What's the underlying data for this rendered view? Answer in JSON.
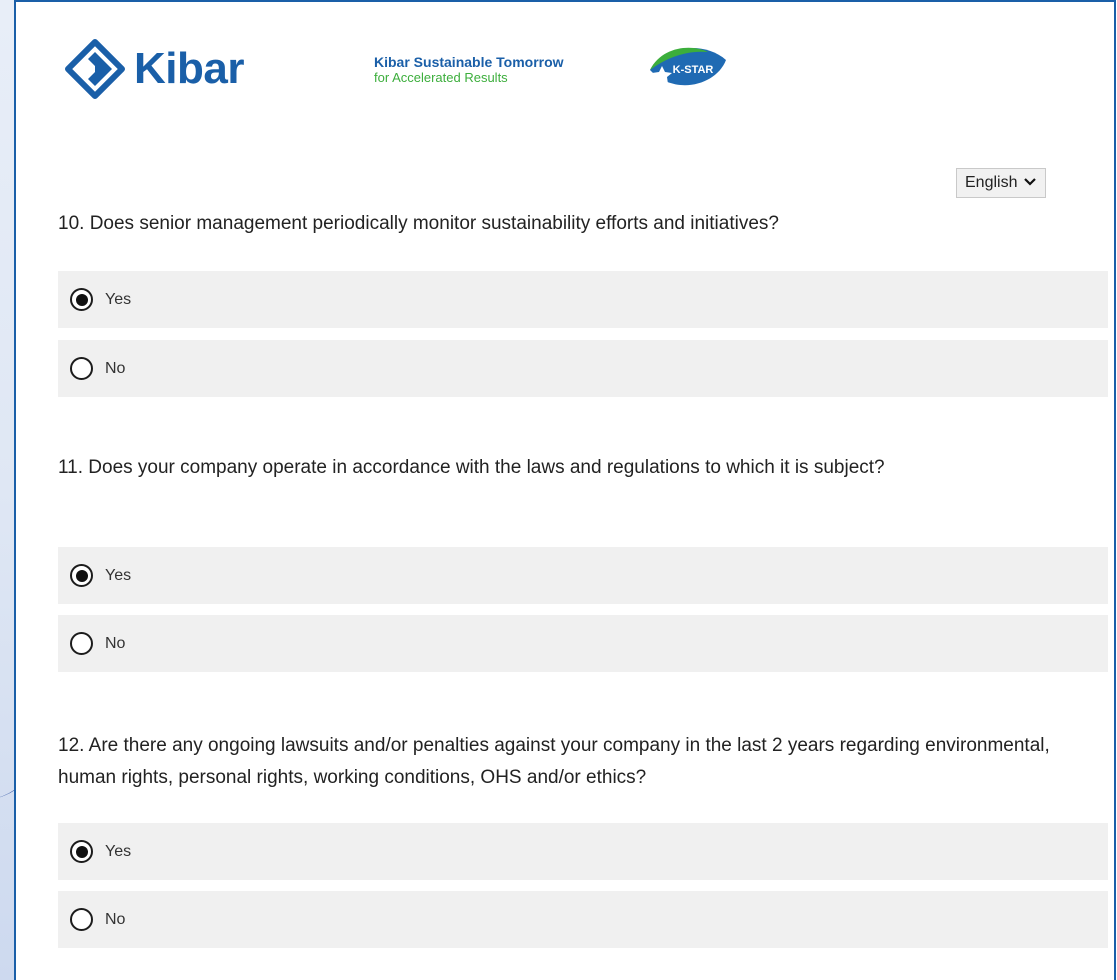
{
  "brand": {
    "name": "Kibar",
    "tagline_line1": "Kibar Sustainable Tomorrow",
    "tagline_line2": "for Accelerated Results",
    "badge": "K-STAR",
    "primary_color": "#1a5fa8",
    "accent_color": "#3cae3c"
  },
  "language": {
    "selected": "English"
  },
  "questions": [
    {
      "text": "10. Does senior management periodically monitor sustainability efforts and initiatives?",
      "options": [
        {
          "label": "Yes",
          "selected": true
        },
        {
          "label": "No",
          "selected": false
        }
      ]
    },
    {
      "text": "11. Does your company operate in accordance with the laws and regulations to which it is subject?",
      "options": [
        {
          "label": "Yes",
          "selected": true
        },
        {
          "label": "No",
          "selected": false
        }
      ]
    },
    {
      "text": "12. Are there any ongoing lawsuits and/or penalties against your company in the last 2 years regarding environmental, human rights, personal rights, working conditions, OHS and/or ethics?",
      "options": [
        {
          "label": "Yes",
          "selected": true
        },
        {
          "label": "No",
          "selected": false
        }
      ]
    }
  ]
}
